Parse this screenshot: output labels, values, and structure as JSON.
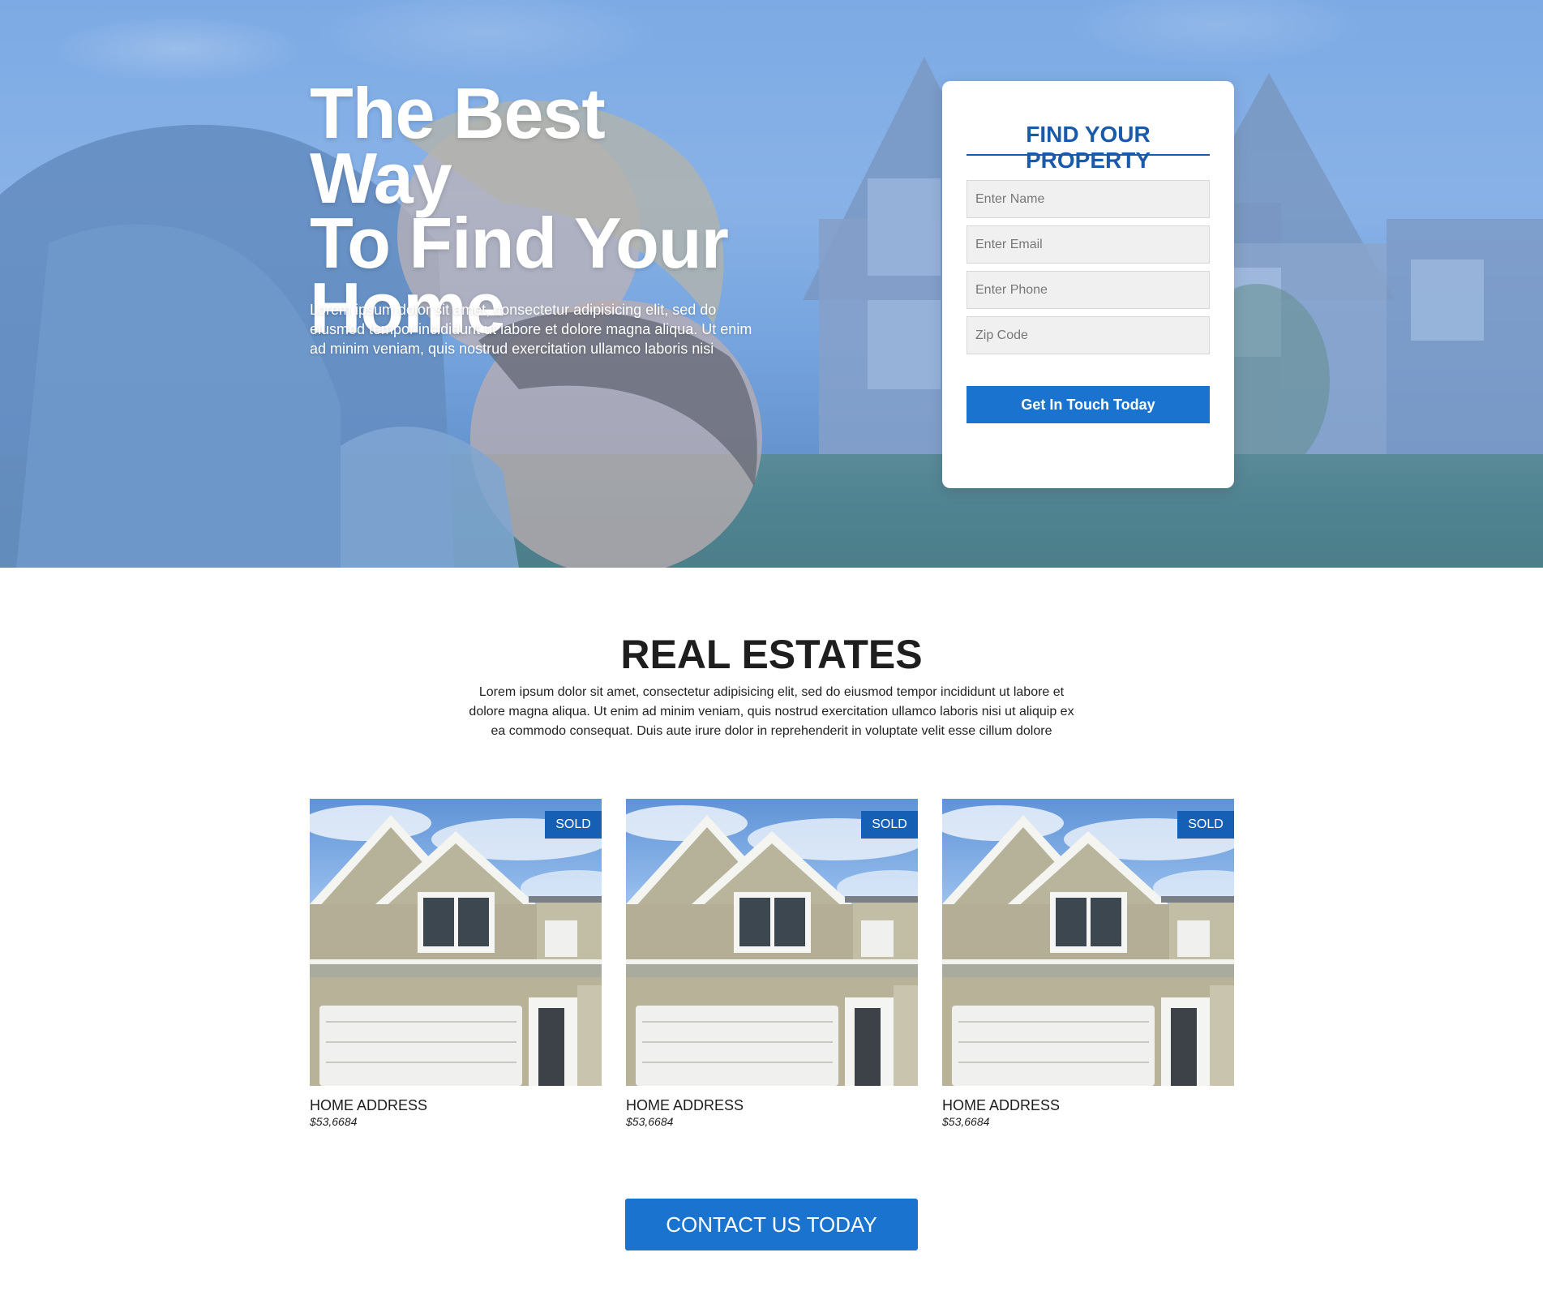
{
  "hero": {
    "title_lines": [
      "The Best Way",
      "To Find Your",
      "Home"
    ],
    "description": "Lorem ipsum dolor sit amet, consectetur adipisicing elit, sed do eiusmod tempor incididunt ut labore et dolore magna aliqua. Ut enim ad minim veniam, quis nostrud exercitation ullamco laboris nisi"
  },
  "form": {
    "title": "FIND YOUR PROPERTY",
    "name_placeholder": "Enter Name",
    "email_placeholder": "Enter Email",
    "phone_placeholder": "Enter Phone",
    "zip_placeholder": "Zip Code",
    "submit_label": "Get In Touch Today"
  },
  "listings_section": {
    "title": "REAL ESTATES",
    "description": "Lorem ipsum dolor sit amet, consectetur adipisicing elit, sed do eiusmod tempor incididunt ut labore et dolore magna aliqua. Ut enim ad minim veniam, quis nostrud exercitation ullamco laboris nisi ut aliquip ex ea commodo consequat. Duis aute irure dolor in reprehenderit in voluptate velit esse cillum dolore",
    "listings": [
      {
        "badge": "SOLD",
        "address": "HOME ADDRESS",
        "price": "$53,6684"
      },
      {
        "badge": "SOLD",
        "address": "HOME ADDRESS",
        "price": "$53,6684"
      },
      {
        "badge": "SOLD",
        "address": "HOME ADDRESS",
        "price": "$53,6684"
      }
    ]
  },
  "cta": {
    "label": "CONTACT US TODAY"
  },
  "colors": {
    "primary": "#1a74cf",
    "heading_blue": "#1a5aa8",
    "badge": "#1560b4"
  }
}
